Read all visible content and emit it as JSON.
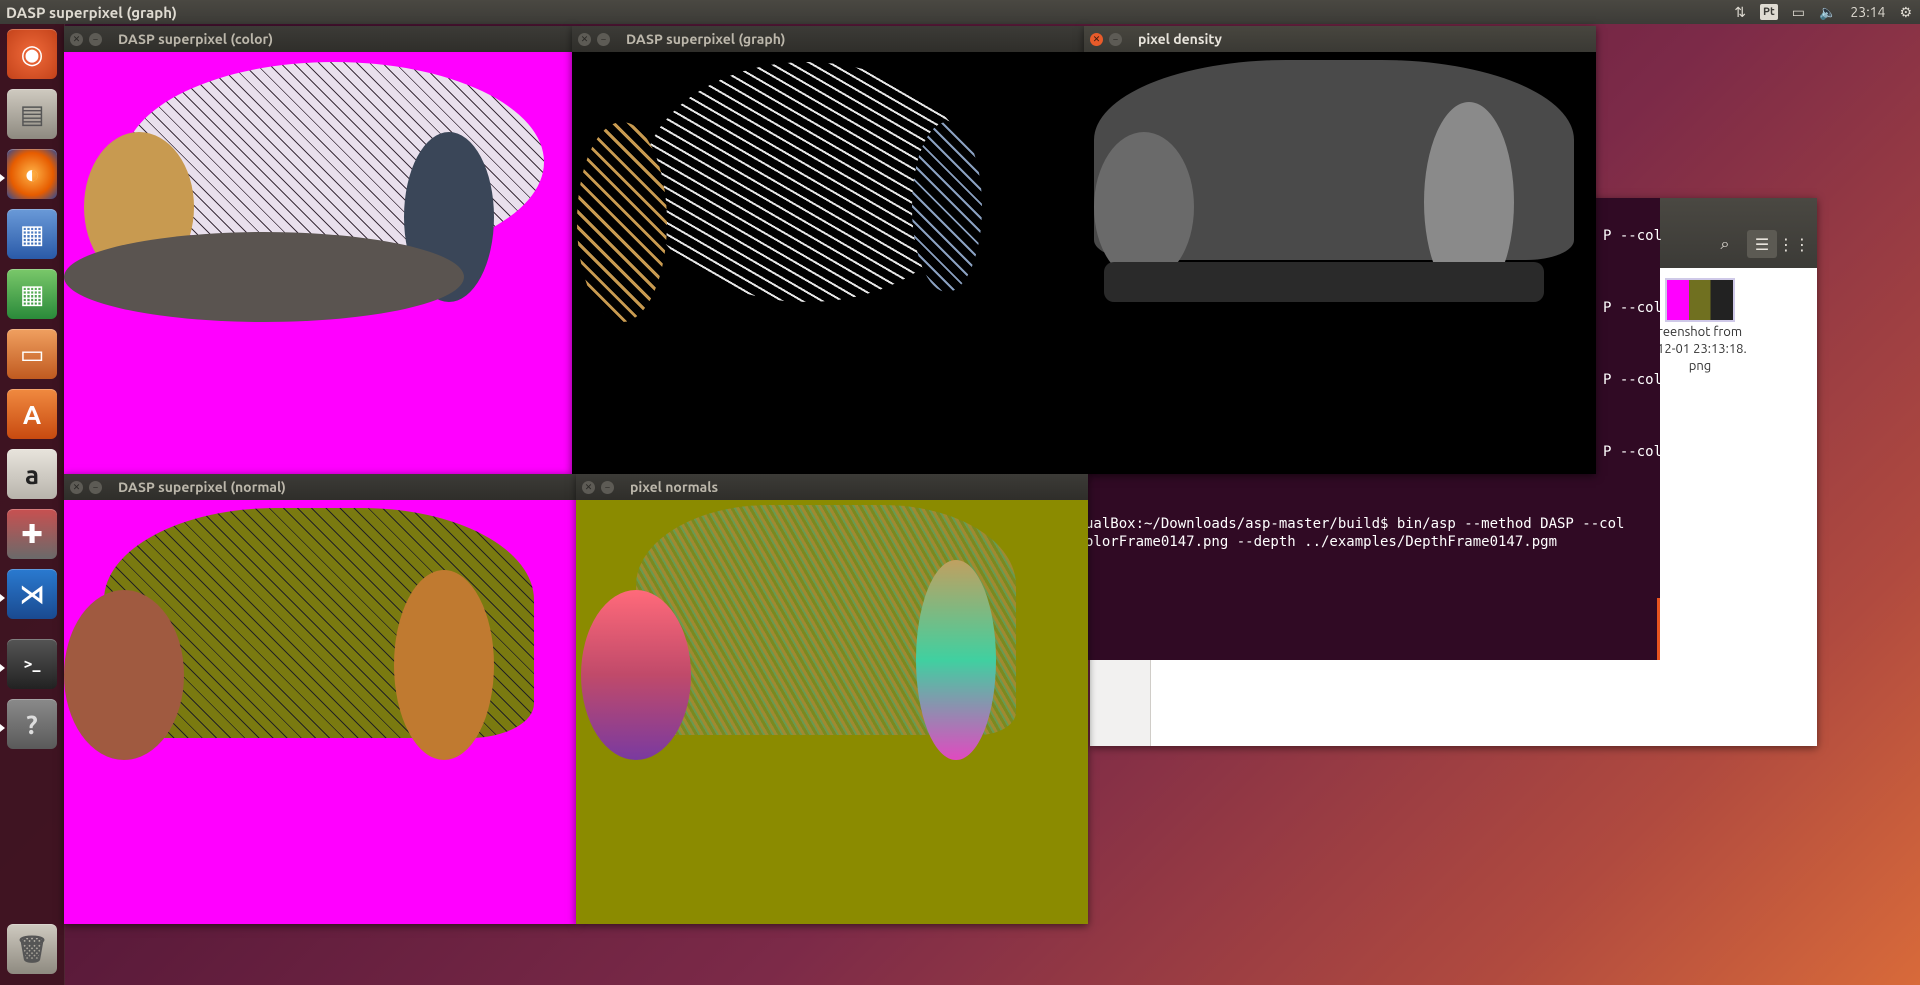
{
  "top_panel": {
    "active_window_title": "DASP superpixel (graph)",
    "keyboard_layout": "Pt",
    "time": "23:14"
  },
  "launcher": {
    "items": [
      {
        "name": "ubuntu-dash-icon"
      },
      {
        "name": "files-icon"
      },
      {
        "name": "firefox-icon"
      },
      {
        "name": "writer-icon"
      },
      {
        "name": "calc-icon"
      },
      {
        "name": "impress-icon"
      },
      {
        "name": "software-center-icon"
      },
      {
        "name": "amazon-icon"
      },
      {
        "name": "system-settings-icon"
      },
      {
        "name": "vscode-icon"
      },
      {
        "name": "terminal-icon"
      },
      {
        "name": "help-icon"
      },
      {
        "name": "trash-icon"
      }
    ]
  },
  "windows": {
    "color": {
      "title": "DASP superpixel (color)"
    },
    "graph": {
      "title": "DASP superpixel (graph)"
    },
    "density": {
      "title": "pixel density"
    },
    "normal": {
      "title": "DASP superpixel (normal)"
    },
    "normals": {
      "title": "pixel normals"
    }
  },
  "terminal": {
    "lines": [
      "P --col",
      "P --col",
      "P --col",
      "P --col",
      "ualBox:~/Downloads/asp-master/build$ bin/asp --method DASP --col",
      "olorFrame0147.png --depth ../examples/DepthFrame0147.pgm"
    ]
  },
  "file_manager": {
    "file_label_line1": "reenshot from",
    "file_label_line2": "-12-01 23:13:18.",
    "file_label_line3": "png"
  },
  "colors": {
    "magenta": "#ff00ff",
    "olive": "#8b8b00",
    "terminal_bg": "#300a24",
    "ubuntu_orange": "#e95420"
  }
}
